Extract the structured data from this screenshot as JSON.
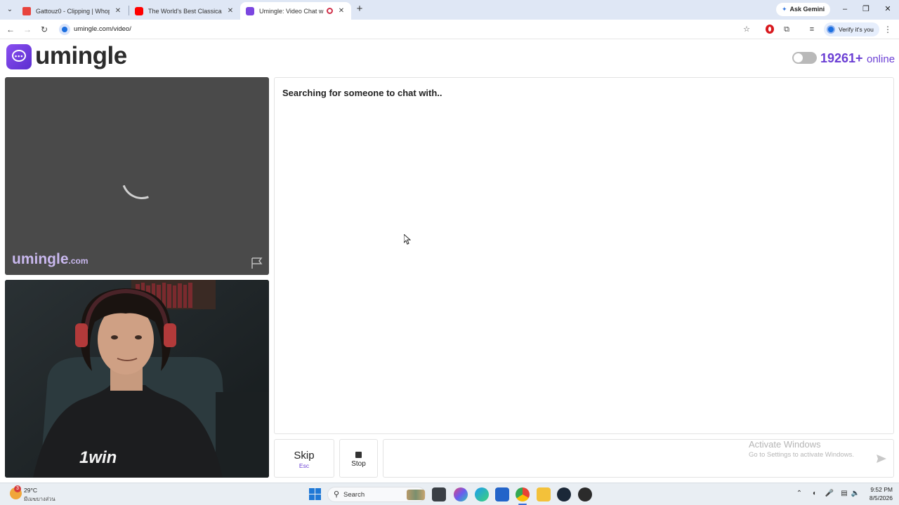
{
  "browser": {
    "tabs": [
      {
        "title": "Gattouz0 - Clipping | Whop",
        "favicon_color": "#e8433d",
        "active": false
      },
      {
        "title": "The World's Best Classical Instr",
        "favicon_color": "#ff0000",
        "active": false
      },
      {
        "title": "Umingle: Video Chat with S",
        "favicon_color": "#7b46e0",
        "active": true
      }
    ],
    "ask_gemini": "Ask Gemini",
    "url": "umingle.com/video/",
    "profile_label": "Verify it's you"
  },
  "site": {
    "logo_text": "umingle",
    "online_count": "19261+",
    "online_label": "online",
    "watermark_name": "umingle",
    "watermark_domain": ".com",
    "status_text": "Searching for someone to chat with..",
    "skip_label": "Skip",
    "skip_key": "Esc",
    "stop_label": "Stop",
    "brand_color": "#6b3fd4"
  },
  "webcam": {
    "shirt_logo": "1win"
  },
  "os": {
    "activate_title": "Activate Windows",
    "activate_sub": "Go to Settings to activate Windows.",
    "weather_temp": "29°C",
    "weather_desc": "มีเมฆบางส่วน",
    "weather_badge": "3",
    "search_label": "Search",
    "time": "9:52 PM",
    "date": "8/5/2026"
  }
}
